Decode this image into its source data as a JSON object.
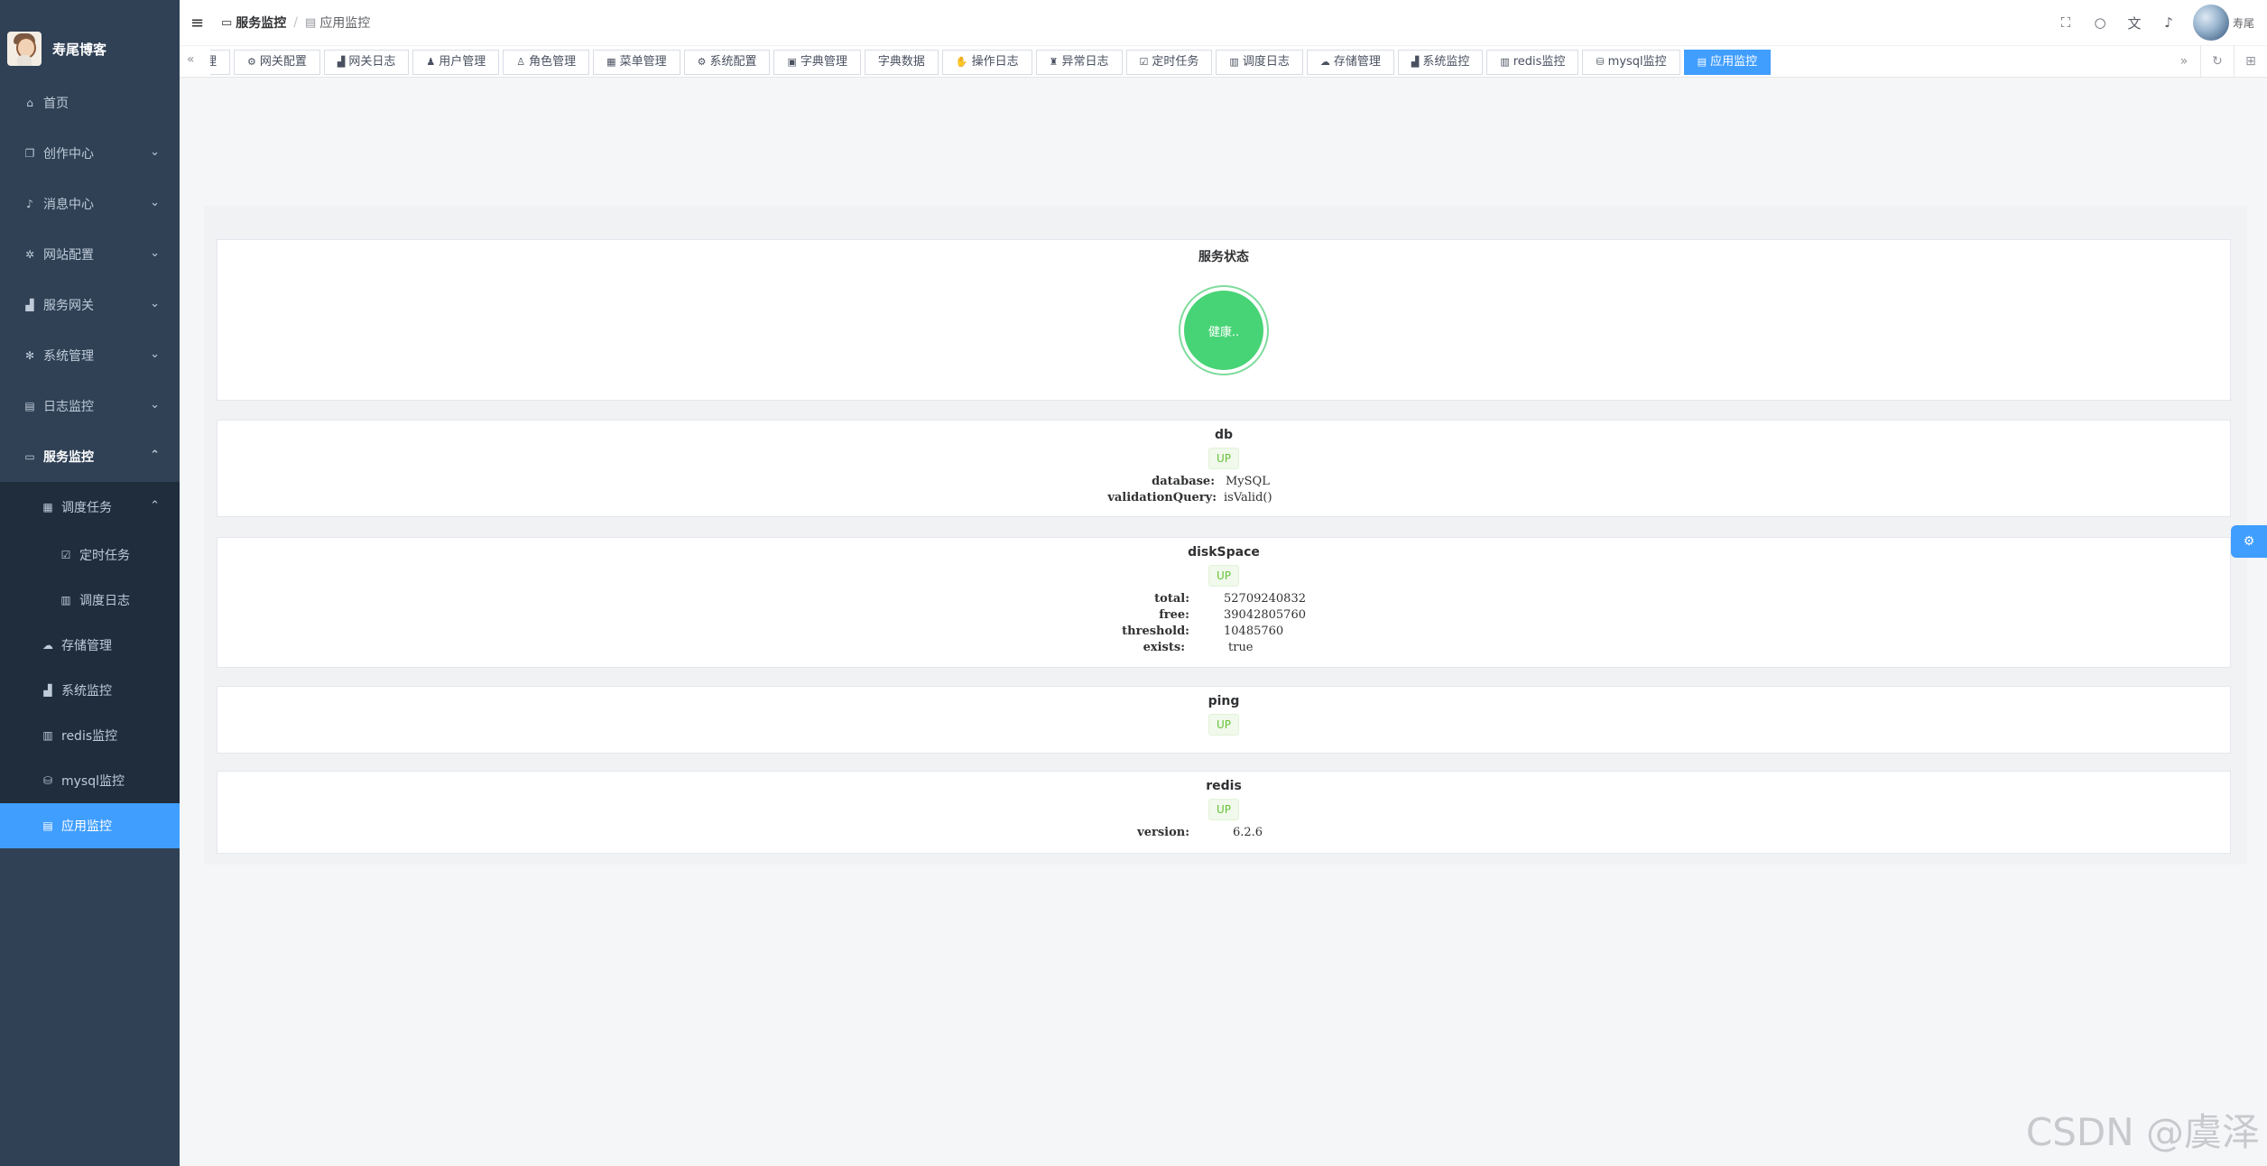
{
  "app": {
    "title": "寿尾博客"
  },
  "sidebar": {
    "items": [
      {
        "label": "首页",
        "icon": "home-icon",
        "glyph": "⌂"
      },
      {
        "label": "创作中心",
        "icon": "document-icon",
        "glyph": "❐"
      },
      {
        "label": "消息中心",
        "icon": "bell-icon",
        "glyph": "♪"
      },
      {
        "label": "网站配置",
        "icon": "gear-icon",
        "glyph": "✲"
      },
      {
        "label": "服务网关",
        "icon": "chart-icon",
        "glyph": "▟"
      },
      {
        "label": "系统管理",
        "icon": "settings-icon",
        "glyph": "✻"
      },
      {
        "label": "日志监控",
        "icon": "log-icon",
        "glyph": "▤"
      },
      {
        "label": "服务监控",
        "icon": "monitor-icon",
        "glyph": "▭"
      }
    ],
    "sub": {
      "group": {
        "label": "调度任务",
        "icon": "calendar-icon",
        "glyph": "▦"
      },
      "group_children": [
        {
          "label": "定时任务",
          "icon": "calendar-check-icon",
          "glyph": "☑"
        },
        {
          "label": "调度日志",
          "icon": "table-icon",
          "glyph": "▥"
        }
      ],
      "items": [
        {
          "label": "存储管理",
          "icon": "cloud-icon",
          "glyph": "☁"
        },
        {
          "label": "系统监控",
          "icon": "chart-icon",
          "glyph": "▟"
        },
        {
          "label": "redis监控",
          "icon": "table-icon",
          "glyph": "▥"
        },
        {
          "label": "mysql监控",
          "icon": "database-icon",
          "glyph": "⛁"
        },
        {
          "label": "应用监控",
          "icon": "list-icon",
          "glyph": "▤"
        }
      ]
    }
  },
  "header": {
    "breadcrumb": {
      "first": "服务监控",
      "sep": "/",
      "last": "应用监控"
    },
    "username": "寿尾"
  },
  "tags": [
    {
      "label": "轮播管理",
      "glyph": ""
    },
    {
      "label": "网关配置",
      "glyph": "⚙"
    },
    {
      "label": "网关日志",
      "glyph": "▟"
    },
    {
      "label": "用户管理",
      "glyph": "♟"
    },
    {
      "label": "角色管理",
      "glyph": "♙"
    },
    {
      "label": "菜单管理",
      "glyph": "▦"
    },
    {
      "label": "系统配置",
      "glyph": "⚙"
    },
    {
      "label": "字典管理",
      "glyph": "▣"
    },
    {
      "label": "字典数据",
      "glyph": ""
    },
    {
      "label": "操作日志",
      "glyph": "✋"
    },
    {
      "label": "异常日志",
      "glyph": "♜"
    },
    {
      "label": "定时任务",
      "glyph": "☑"
    },
    {
      "label": "调度日志",
      "glyph": "▥"
    },
    {
      "label": "存储管理",
      "glyph": "☁"
    },
    {
      "label": "系统监控",
      "glyph": "▟"
    },
    {
      "label": "redis监控",
      "glyph": "▥"
    },
    {
      "label": "mysql监控",
      "glyph": "⛁"
    },
    {
      "label": "应用监控",
      "glyph": "▤"
    }
  ],
  "main": {
    "service_status": {
      "title": "服务状态",
      "status": "健康.."
    },
    "db": {
      "title": "db",
      "status": "UP",
      "details": [
        {
          "key": "database:",
          "value": "MySQL"
        },
        {
          "key": "validationQuery:",
          "value": "isValid()"
        }
      ]
    },
    "diskSpace": {
      "title": "diskSpace",
      "status": "UP",
      "details": [
        {
          "key": "total:",
          "value": "52709240832"
        },
        {
          "key": "free:",
          "value": "39042805760"
        },
        {
          "key": "threshold:",
          "value": "10485760"
        },
        {
          "key": "exists:",
          "value": "true"
        }
      ]
    },
    "ping": {
      "title": "ping",
      "status": "UP"
    },
    "redis": {
      "title": "redis",
      "status": "UP",
      "details": [
        {
          "key": "version:",
          "value": "6.2.6"
        }
      ]
    }
  },
  "watermark": "CSDN @虞泽",
  "colors": {
    "sidebar_bg": "#304156",
    "sidebar_sub_bg": "#1f2d3d",
    "accent": "#409eff",
    "healthy": "#47d476",
    "up_text": "#67c23a"
  }
}
